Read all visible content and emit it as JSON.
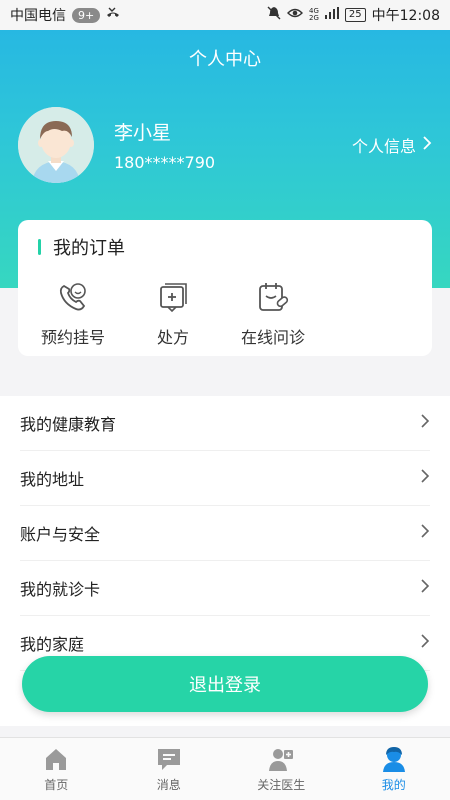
{
  "status_bar": {
    "carrier": "中国电信",
    "notification_badge": "9+",
    "network": [
      "4G",
      "2G"
    ],
    "battery": "25",
    "time": "中午12:08"
  },
  "header": {
    "title": "个人中心"
  },
  "profile": {
    "name": "李小星",
    "phone": "180*****790",
    "info_link": "个人信息"
  },
  "orders": {
    "title": "我的订单",
    "items": [
      {
        "label": "预约挂号",
        "icon": "phone-appointment-icon"
      },
      {
        "label": "处方",
        "icon": "prescription-icon"
      },
      {
        "label": "在线问诊",
        "icon": "online-consultation-icon"
      }
    ]
  },
  "menu": {
    "items": [
      {
        "label": "我的健康教育"
      },
      {
        "label": "我的地址"
      },
      {
        "label": "账户与安全"
      },
      {
        "label": "我的就诊卡"
      },
      {
        "label": "我的家庭"
      }
    ]
  },
  "logout": {
    "label": "退出登录"
  },
  "tabbar": {
    "items": [
      {
        "label": "首页",
        "icon": "home-icon"
      },
      {
        "label": "消息",
        "icon": "message-icon"
      },
      {
        "label": "关注医生",
        "icon": "doctor-icon"
      },
      {
        "label": "我的",
        "icon": "user-icon"
      }
    ]
  },
  "colors": {
    "accent": "#26d4a7",
    "header_top": "#27b8e2",
    "header_bottom": "#36d7c0",
    "tab_active": "#1a8de6"
  }
}
